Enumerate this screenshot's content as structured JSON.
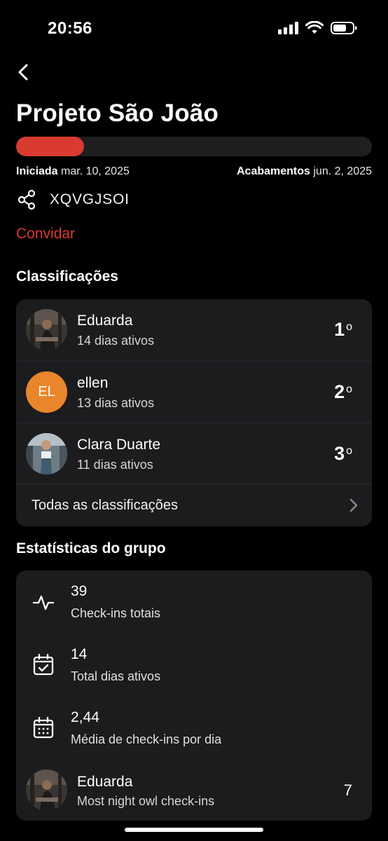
{
  "status_bar": {
    "time": "20:56"
  },
  "header": {
    "title": "Projeto São João"
  },
  "progress": {
    "fraction": 0.19,
    "color": "#d93b30"
  },
  "dates": {
    "start_label": "Iniciada",
    "start_value": "mar. 10, 2025",
    "end_label": "Acabamentos",
    "end_value": "jun. 2, 2025"
  },
  "invite": {
    "share_icon": "share-icon",
    "code": "XQVGJSOI",
    "invite_label": "Convidar"
  },
  "rankings": {
    "title": "Classificações",
    "items": [
      {
        "name": "Eduarda",
        "sub": "14 dias ativos",
        "position": "1",
        "suffix": "o",
        "avatar": "photo"
      },
      {
        "name": "ellen",
        "sub": "13 dias ativos",
        "position": "2",
        "suffix": "o",
        "avatar": "initials",
        "initials": "EL",
        "avatar_color": "#e9862b"
      },
      {
        "name": "Clara Duarte",
        "sub": "11 dias ativos",
        "position": "3",
        "suffix": "o",
        "avatar": "photo"
      }
    ],
    "all_label": "Todas as classificações"
  },
  "stats": {
    "title": "Estatísticas do grupo",
    "items": [
      {
        "icon": "activity-icon",
        "value": "39",
        "label": "Check-ins totais"
      },
      {
        "icon": "calendar-check-icon",
        "value": "14",
        "label": "Total dias ativos"
      },
      {
        "icon": "calendar-grid-icon",
        "value": "2,44",
        "label": "Média de check-ins por dia"
      }
    ],
    "highlight": {
      "name": "Eduarda",
      "label": "Most night owl check-ins",
      "value": "7"
    }
  }
}
